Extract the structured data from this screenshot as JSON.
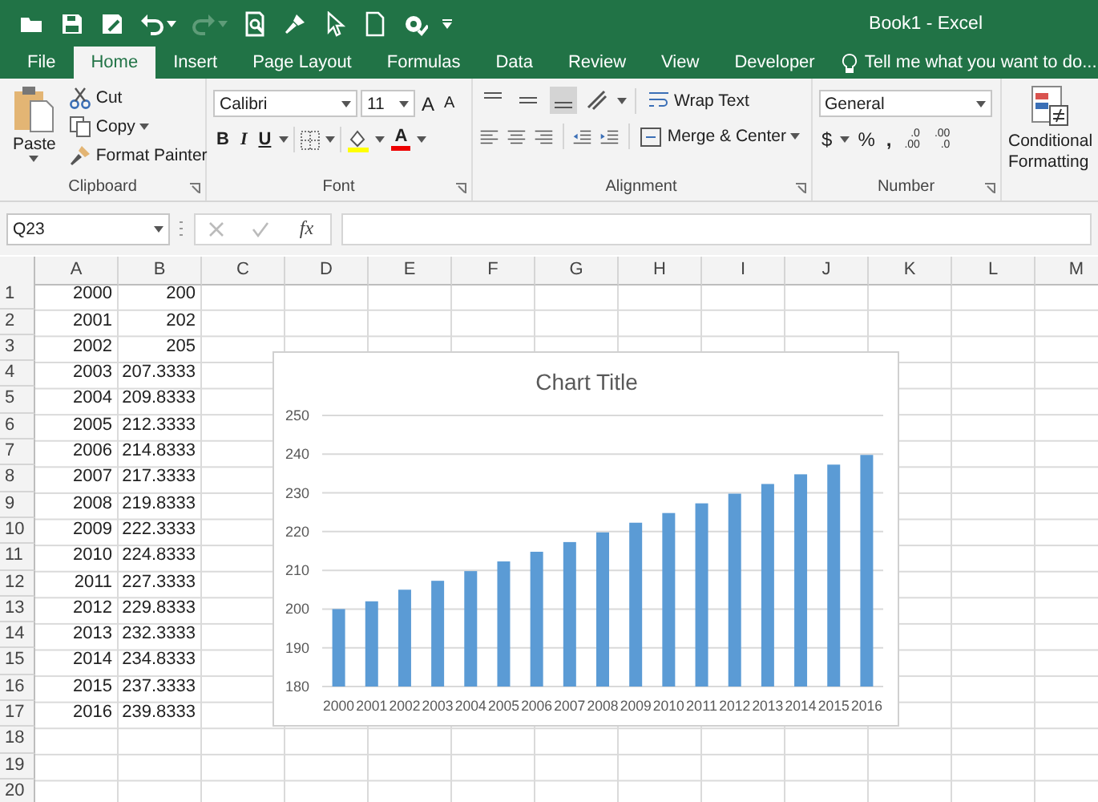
{
  "window": {
    "title": "Book1 - Excel"
  },
  "tabs": [
    {
      "label": "File",
      "selected": false
    },
    {
      "label": "Home",
      "selected": true
    },
    {
      "label": "Insert",
      "selected": false
    },
    {
      "label": "Page Layout",
      "selected": false
    },
    {
      "label": "Formulas",
      "selected": false
    },
    {
      "label": "Data",
      "selected": false
    },
    {
      "label": "Review",
      "selected": false
    },
    {
      "label": "View",
      "selected": false
    },
    {
      "label": "Developer",
      "selected": false
    }
  ],
  "tell_me": {
    "placeholder": "Tell me what you want to do..."
  },
  "ribbon": {
    "clipboard": {
      "paste": "Paste",
      "cut": "Cut",
      "copy": "Copy",
      "format_painter": "Format Painter",
      "label": "Clipboard"
    },
    "font": {
      "font_name": "Calibri",
      "font_size": "11",
      "grow": "A",
      "shrink": "A",
      "bold": "B",
      "italic": "I",
      "underline": "U",
      "font_color": "A",
      "label": "Font"
    },
    "alignment": {
      "wrap_text": "Wrap Text",
      "merge": "Merge & Center",
      "label": "Alignment"
    },
    "number": {
      "format": "General",
      "currency": "$",
      "percent": "%",
      "comma": ",",
      "decimals": [
        {
          "top": ".0",
          "bottom": ".00"
        },
        {
          "top": ".00",
          "bottom": ".0"
        }
      ],
      "label": "Number"
    },
    "styles": {
      "conditional_formatting": "Conditional Formatting"
    }
  },
  "formula_bar": {
    "name_box": "Q23",
    "fx": "fx"
  },
  "sheet": {
    "columns": [
      "A",
      "B",
      "C",
      "D",
      "E",
      "F",
      "G",
      "H",
      "I",
      "J",
      "K",
      "L",
      "M"
    ],
    "rows": [
      {
        "number": "1",
        "a": "2000",
        "b": "200"
      },
      {
        "number": "2",
        "a": "2001",
        "b": "202"
      },
      {
        "number": "3",
        "a": "2002",
        "b": "205"
      },
      {
        "number": "4",
        "a": "2003",
        "b": "207.3333"
      },
      {
        "number": "5",
        "a": "2004",
        "b": "209.8333"
      },
      {
        "number": "6",
        "a": "2005",
        "b": "212.3333"
      },
      {
        "number": "7",
        "a": "2006",
        "b": "214.8333"
      },
      {
        "number": "8",
        "a": "2007",
        "b": "217.3333"
      },
      {
        "number": "9",
        "a": "2008",
        "b": "219.8333"
      },
      {
        "number": "10",
        "a": "2009",
        "b": "222.3333"
      },
      {
        "number": "11",
        "a": "2010",
        "b": "224.8333"
      },
      {
        "number": "12",
        "a": "2011",
        "b": "227.3333"
      },
      {
        "number": "13",
        "a": "2012",
        "b": "229.8333"
      },
      {
        "number": "14",
        "a": "2013",
        "b": "232.3333"
      },
      {
        "number": "15",
        "a": "2014",
        "b": "234.8333"
      },
      {
        "number": "16",
        "a": "2015",
        "b": "237.3333"
      },
      {
        "number": "17",
        "a": "2016",
        "b": "239.8333"
      },
      {
        "number": "18"
      },
      {
        "number": "19"
      },
      {
        "number": "20"
      }
    ]
  },
  "chart": {
    "chart_data": {
      "type": "bar",
      "title": "Chart Title",
      "categories": [
        "2000",
        "2001",
        "2002",
        "2003",
        "2004",
        "2005",
        "2006",
        "2007",
        "2008",
        "2009",
        "2010",
        "2011",
        "2012",
        "2013",
        "2014",
        "2015",
        "2016"
      ],
      "series": [
        {
          "color": "#5b9bd5",
          "values": [
            200,
            202,
            205,
            207.3,
            209.8,
            212.3,
            214.8,
            217.3,
            219.8,
            222.3,
            224.8,
            227.3,
            229.8,
            232.3,
            234.8,
            237.3,
            239.8
          ]
        }
      ],
      "grid": true,
      "ylim": [
        180,
        250
      ],
      "yticks": [
        180,
        190,
        200,
        210,
        220,
        230,
        240,
        250
      ]
    }
  }
}
